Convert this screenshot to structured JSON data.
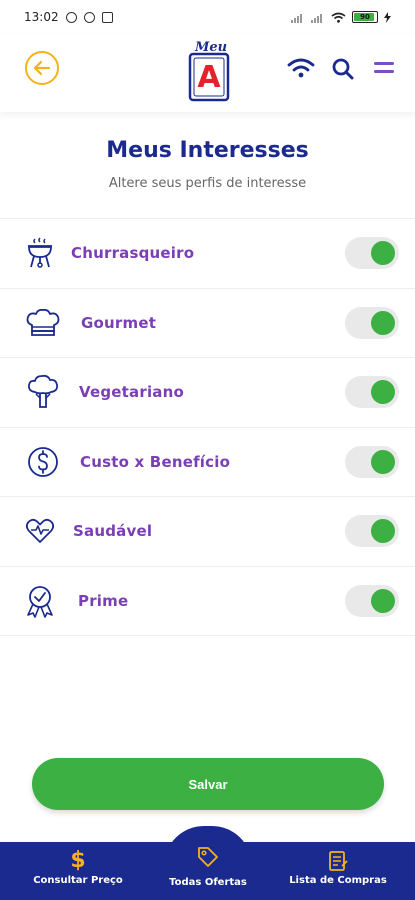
{
  "status_bar": {
    "time": "13:02",
    "battery_level": "90"
  },
  "header": {
    "logo_small_text": "Meu",
    "logo_letter": "A"
  },
  "page": {
    "title": "Meus Interesses",
    "subtitle": "Altere seus perfis de interesse"
  },
  "interests": [
    {
      "label": "Churrasqueiro",
      "icon": "grill-icon",
      "enabled": true
    },
    {
      "label": "Gourmet",
      "icon": "chef-hat-icon",
      "enabled": true
    },
    {
      "label": "Vegetariano",
      "icon": "broccoli-icon",
      "enabled": true
    },
    {
      "label": "Custo x Benefício",
      "icon": "dollar-circle-icon",
      "enabled": true
    },
    {
      "label": "Saudável",
      "icon": "heart-pulse-icon",
      "enabled": true
    },
    {
      "label": "Prime",
      "icon": "award-ribbon-icon",
      "enabled": true
    }
  ],
  "actions": {
    "save_label": "Salvar"
  },
  "bottom_nav": [
    {
      "label": "Consultar Preço",
      "icon": "dollar-sign-icon"
    },
    {
      "label": "Todas Ofertas",
      "icon": "price-tag-icon"
    },
    {
      "label": "Lista de Compras",
      "icon": "shopping-list-icon"
    }
  ],
  "colors": {
    "brand_blue": "#1b2a8f",
    "accent_purple": "#7b3fb5",
    "toggle_green": "#3cb043",
    "back_orange": "#f5b21b",
    "logo_red": "#e4222a"
  }
}
